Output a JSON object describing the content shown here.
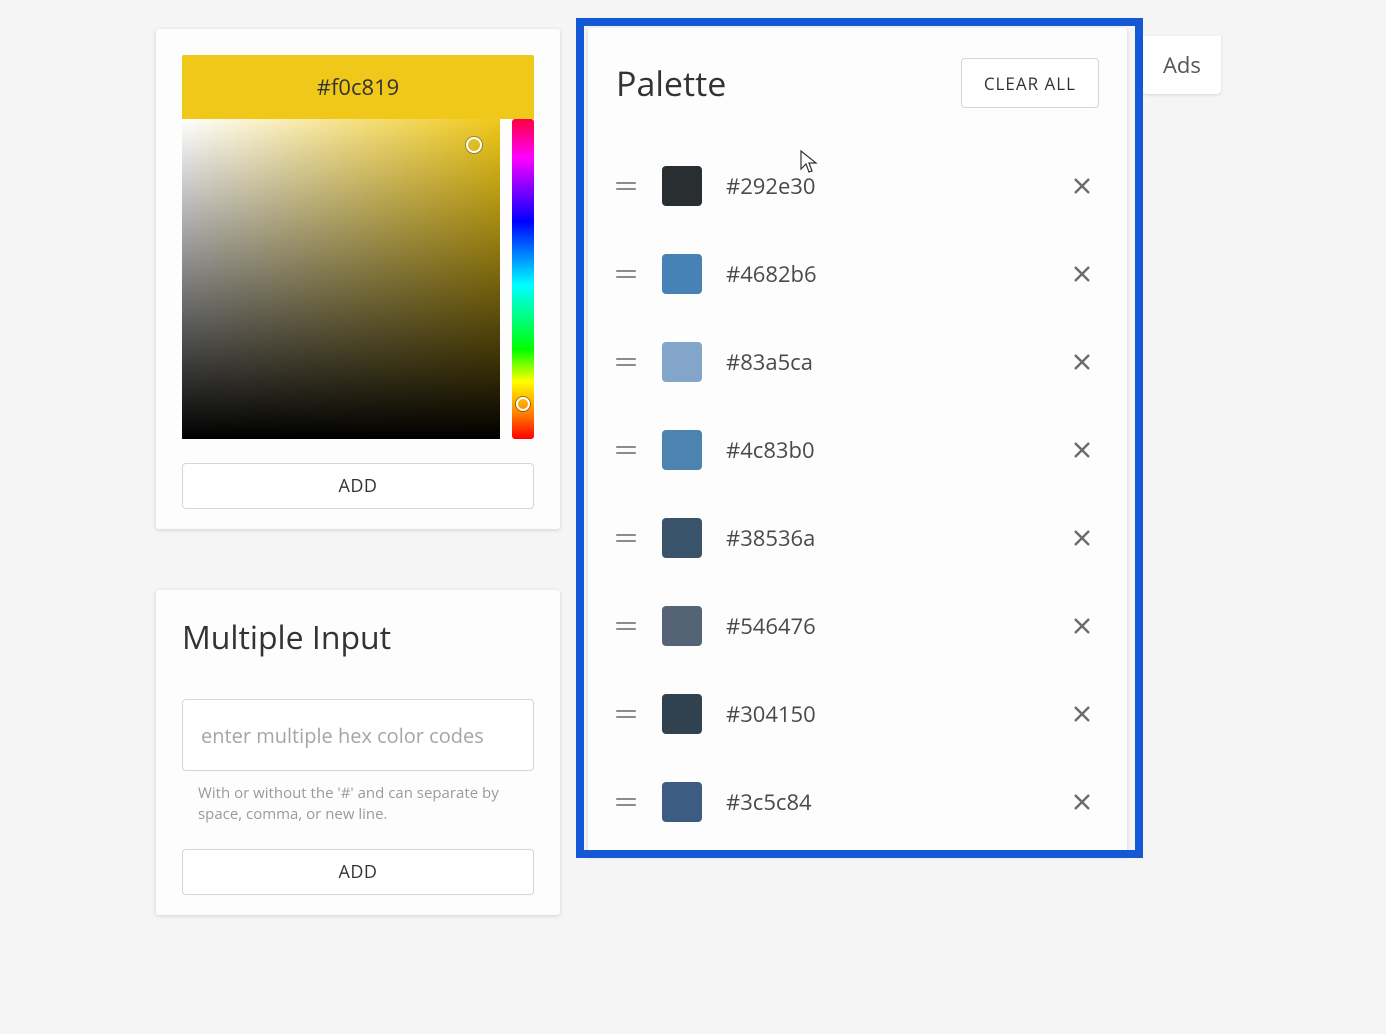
{
  "picker": {
    "hex": "#f0c819",
    "header_bg": "#f0c819",
    "add_label": "ADD"
  },
  "multi": {
    "title": "Multiple Input",
    "placeholder": "enter multiple hex color codes",
    "hint": "With or without the '#' and can separate by space, comma, or new line.",
    "add_label": "ADD"
  },
  "palette": {
    "title": "Palette",
    "clear_label": "CLEAR ALL",
    "items": [
      {
        "hex": "#292e30"
      },
      {
        "hex": "#4682b6"
      },
      {
        "hex": "#83a5ca"
      },
      {
        "hex": "#4c83b0"
      },
      {
        "hex": "#38536a"
      },
      {
        "hex": "#546476"
      },
      {
        "hex": "#304150"
      },
      {
        "hex": "#3c5c84"
      }
    ]
  },
  "ads": {
    "label": "Ads"
  }
}
